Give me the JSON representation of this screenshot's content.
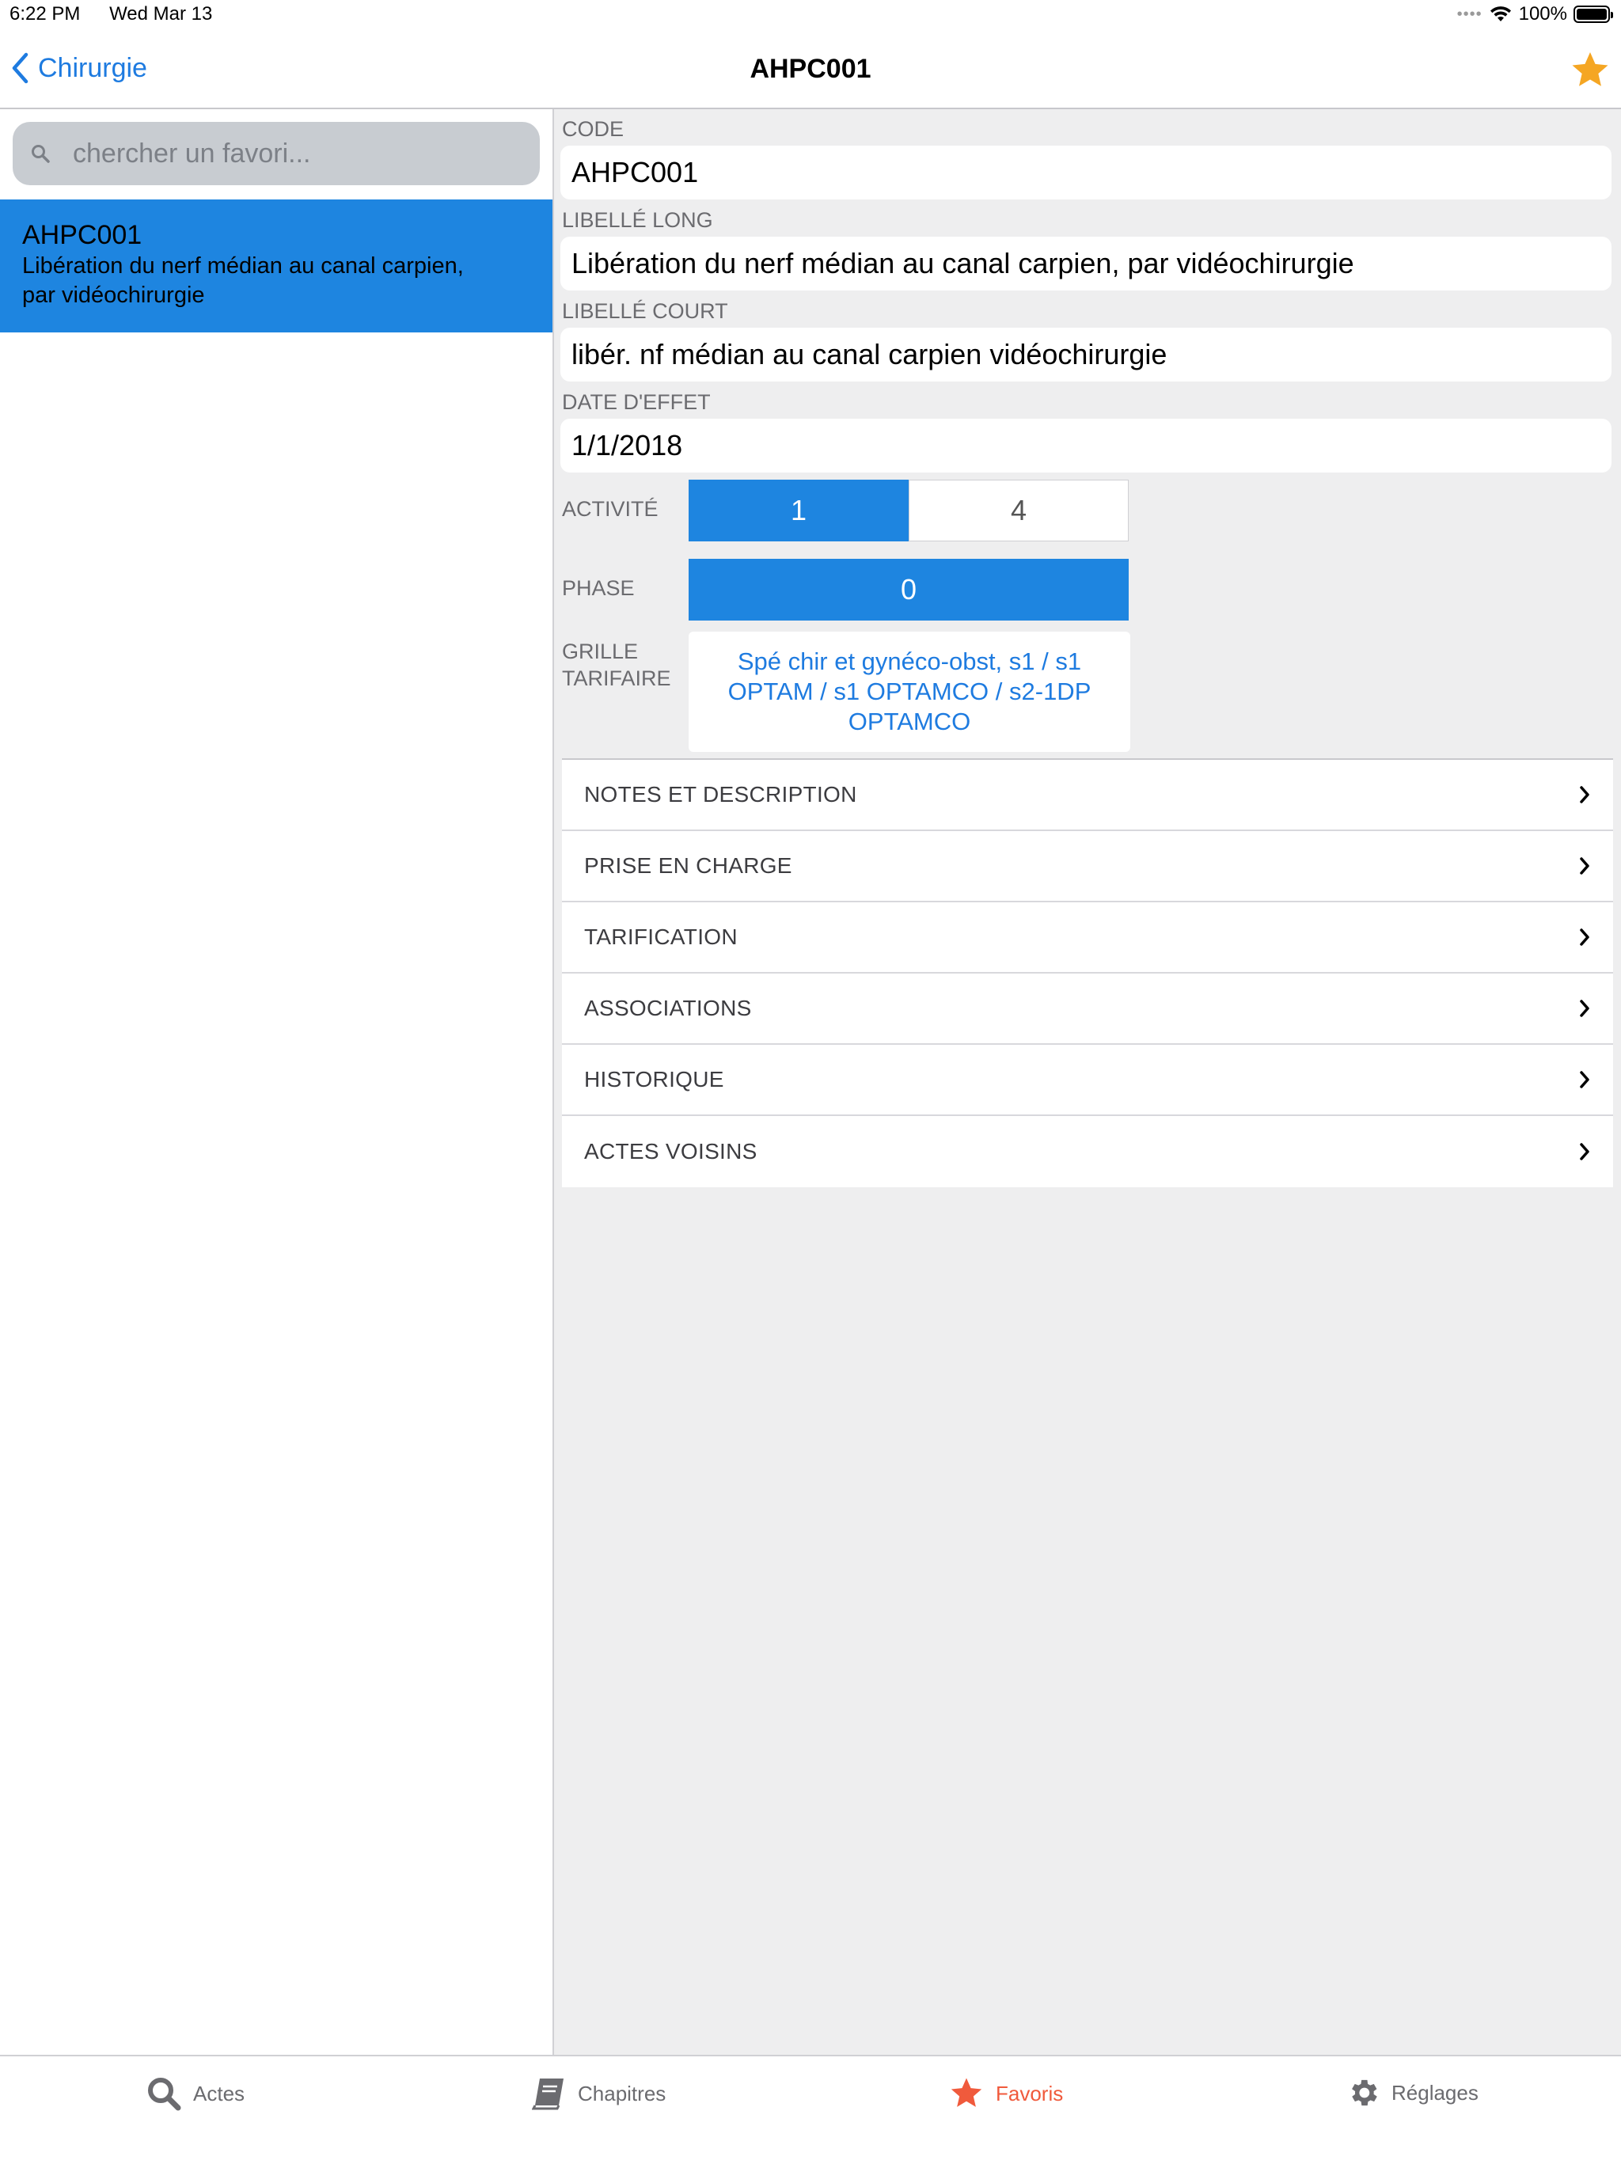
{
  "status_bar": {
    "time": "6:22 PM",
    "date": "Wed Mar 13",
    "battery": "100%"
  },
  "nav": {
    "back_label": "Chirurgie",
    "title": "AHPC001"
  },
  "sidebar": {
    "search_placeholder": "chercher un favori...",
    "favorites": [
      {
        "code": "AHPC001",
        "label": "Libération du nerf médian au canal carpien, par vidéochirurgie"
      }
    ]
  },
  "detail": {
    "code_label": "CODE",
    "code_value": "AHPC001",
    "long_label": "LIBELLÉ LONG",
    "long_value": "Libération du nerf médian au canal carpien, par vidéochirurgie",
    "short_label": "LIBELLÉ COURT",
    "short_value": "libér. nf médian au canal carpien vidéochirurgie",
    "date_label": "DATE D'EFFET",
    "date_value": "1/1/2018",
    "activite_label": "ACTIVITÉ",
    "activite_options": [
      "1",
      "4"
    ],
    "phase_label": "PHASE",
    "phase_options": [
      "0"
    ],
    "grille_label_1": "GRILLE",
    "grille_label_2": "TARIFAIRE",
    "grille_value": "Spé chir et gynéco-obst, s1 /  s1 OPTAM / s1 OPTAMCO / s2-1DP OPTAMCO",
    "menu": [
      "NOTES ET DESCRIPTION",
      "PRISE EN CHARGE",
      "TARIFICATION",
      "ASSOCIATIONS",
      "HISTORIQUE",
      "ACTES VOISINS"
    ]
  },
  "tabs": [
    {
      "label": "Actes",
      "icon": "search-icon"
    },
    {
      "label": "Chapitres",
      "icon": "book-icon"
    },
    {
      "label": "Favoris",
      "icon": "star-icon"
    },
    {
      "label": "Réglages",
      "icon": "gear-icon"
    }
  ],
  "colors": {
    "accent": "#1e85e0",
    "link": "#1e7be0",
    "active_tab": "#f05a3c",
    "star": "#f5a623"
  }
}
